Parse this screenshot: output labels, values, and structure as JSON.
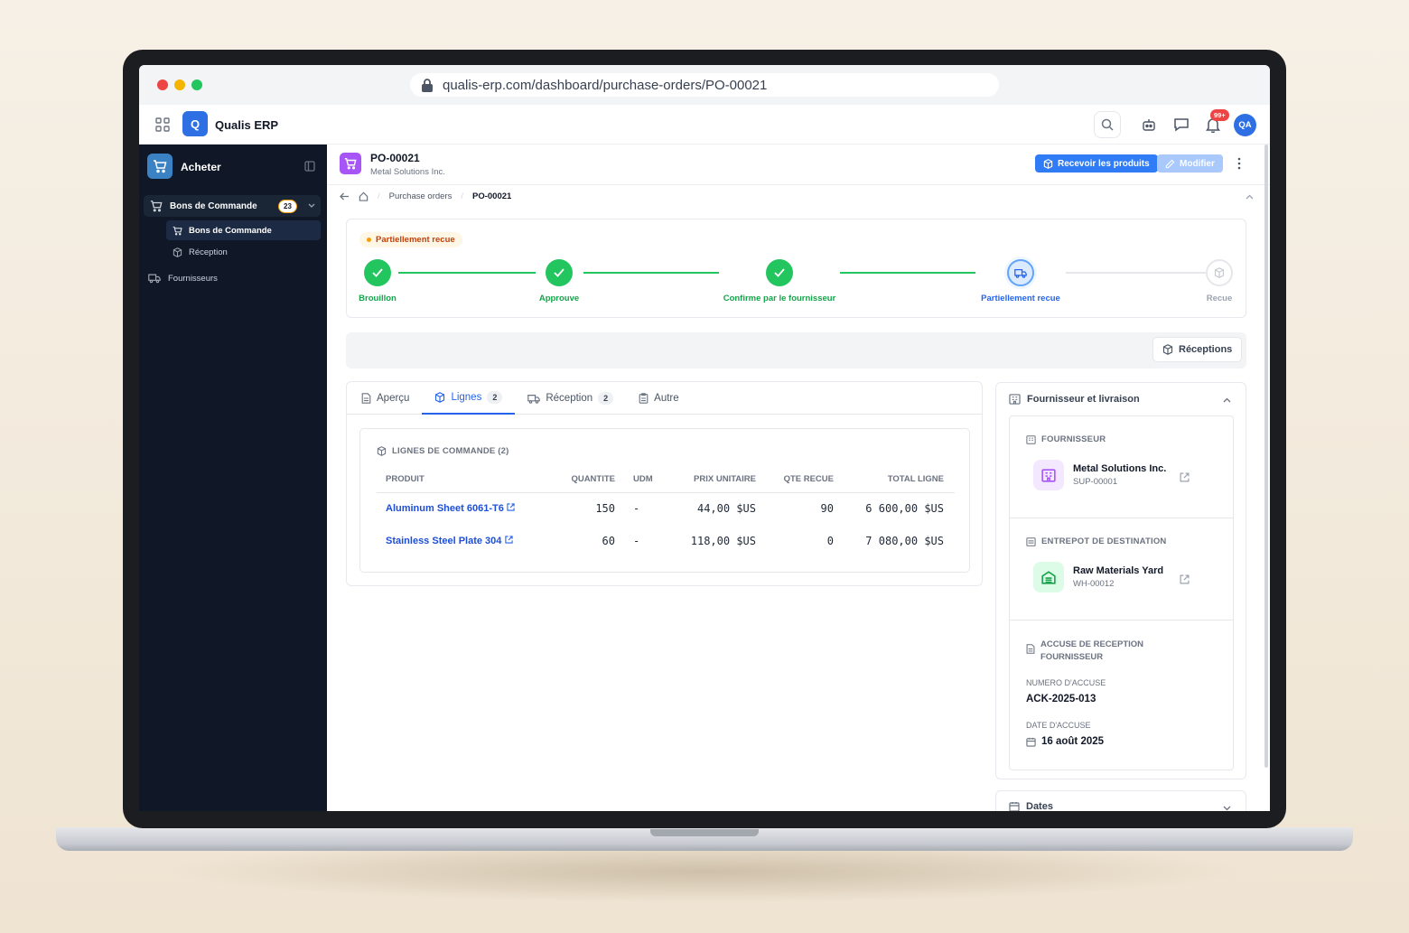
{
  "browser": {
    "url": "qualis-erp.com/dashboard/purchase-orders/PO-00021"
  },
  "app": {
    "logo_letter": "Q",
    "name": "Qualis ERP",
    "notifications_count": "99+",
    "user_initials": "QA"
  },
  "sidebar": {
    "module_title": "Acheter",
    "group": {
      "label": "Bons de Commande",
      "count": "23"
    },
    "sub_items": [
      {
        "label": "Bons de Commande",
        "active": true
      },
      {
        "label": "Réception",
        "active": false
      }
    ],
    "items": [
      {
        "label": "Fournisseurs"
      }
    ]
  },
  "header": {
    "po_number": "PO-00021",
    "supplier_name": "Metal Solutions Inc.",
    "receive_button": "Recevoir les produits",
    "edit_button": "Modifier"
  },
  "breadcrumb": {
    "section": "Purchase orders",
    "current": "PO-00021"
  },
  "status": {
    "label": "Partiellement recue",
    "steps": [
      {
        "label": "Brouillon",
        "state": "done"
      },
      {
        "label": "Approuve",
        "state": "done"
      },
      {
        "label": "Confirme par le fournisseur",
        "state": "done"
      },
      {
        "label": "Partiellement recue",
        "state": "current"
      },
      {
        "label": "Recue",
        "state": "pending"
      }
    ]
  },
  "toolbar": {
    "receptions_button": "Réceptions"
  },
  "tabs": [
    {
      "label": "Aperçu",
      "count": ""
    },
    {
      "label": "Lignes",
      "count": "2"
    },
    {
      "label": "Réception",
      "count": "2"
    },
    {
      "label": "Autre",
      "count": ""
    }
  ],
  "lines": {
    "title": "LIGNES DE COMMANDE (2)",
    "columns": [
      "PRODUIT",
      "QUANTITE",
      "UDM",
      "PRIX UNITAIRE",
      "QTE RECUE",
      "TOTAL LIGNE"
    ],
    "rows": [
      {
        "product": "Aluminum Sheet 6061-T6",
        "qty": "150",
        "uom": "-",
        "unit_price": "44,00 $US",
        "received": "90",
        "total": "6 600,00 $US"
      },
      {
        "product": "Stainless Steel Plate 304",
        "qty": "60",
        "uom": "-",
        "unit_price": "118,00 $US",
        "received": "0",
        "total": "7 080,00 $US"
      }
    ]
  },
  "side_panel": {
    "title": "Fournisseur et livraison",
    "supplier": {
      "label": "FOURNISSEUR",
      "name": "Metal Solutions Inc.",
      "code": "SUP-00001"
    },
    "warehouse": {
      "label": "ENTREPOT DE DESTINATION",
      "name": "Raw Materials Yard",
      "code": "WH-00012"
    },
    "ack": {
      "label_line1": "ACCUSE DE RECEPTION",
      "label_line2": "FOURNISSEUR",
      "number_label": "NUMERO D'ACCUSE",
      "number": "ACK-2025-013",
      "date_label": "DATE D'ACCUSE",
      "date": "16 août 2025"
    },
    "dates_title": "Dates"
  },
  "colors": {
    "accent": "#2f7cf6",
    "success": "#22c55e",
    "warning": "#f59e0b",
    "sidebar": "#101827",
    "purple": "#a855f7"
  }
}
